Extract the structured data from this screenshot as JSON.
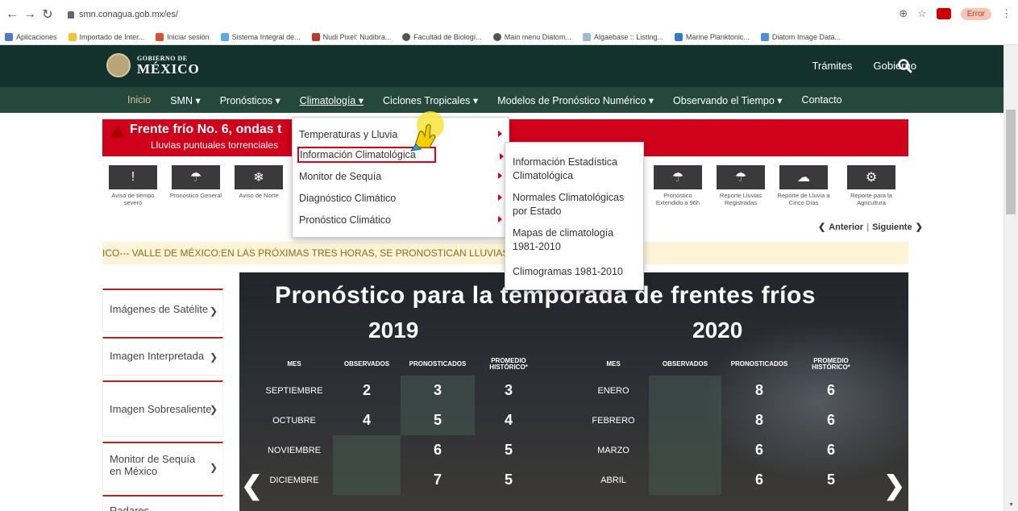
{
  "browser": {
    "url": "smn.conagua.gob.mx/es/",
    "error_label": "Error",
    "bookmarks": [
      "Aplicaciones",
      "Importado de Inter...",
      "Iniciar sesión",
      "Sistema Integral de...",
      "Nudi Pixel: Nudibra...",
      "Facultad de Biologí...",
      "Main menu Diatom...",
      "Algaebase :: Listing...",
      "Marine Planktonic...",
      "Diatom Image Data..."
    ]
  },
  "header": {
    "logo_small": "GOBIERNO DE",
    "logo_big": "MÉXICO",
    "tramites": "Trámites",
    "gobierno": "Gobierno"
  },
  "nav": [
    "Inicio",
    "SMN ▾",
    "Pronósticos ▾",
    "Climatología ▾",
    "Ciclones Tropicales ▾",
    "Modelos de Pronóstico Numérico ▾",
    "Observando el Tiempo ▾",
    "Contacto"
  ],
  "alert": {
    "title": "Frente frío No. 6, ondas t",
    "subtitle": "Lluvias puntuales torrenciales"
  },
  "quick_links": [
    {
      "label": "Aviso de tiempo severo",
      "icon": "!"
    },
    {
      "label": "Pronóstico General",
      "icon": "☂"
    },
    {
      "label": "Aviso de Norte",
      "icon": "❄"
    },
    {
      "label": "Pronóstico Extendido a 96h",
      "icon": "☂"
    },
    {
      "label": "Reporte Lluvias Registradas",
      "icon": "☂"
    },
    {
      "label": "Reporte de Lluvia a Cinco Días",
      "icon": "☁"
    },
    {
      "label": "Reporte para la Agricultura",
      "icon": "⚙"
    }
  ],
  "pager": {
    "prev": "Anterior",
    "next": "Siguiente"
  },
  "ticker": "ICO--- VALLE DE MÉXICO:EN LAS PRÓXIMAS TRES HORAS, SE PRONOSTICAN LLUVIAS                                                  E MÉXICO---",
  "sidebar": [
    "Imágenes de Satélite",
    "Imagen Interpretada",
    "Imagen Sobresaliente",
    "Monitor de Sequía en México",
    "Radares"
  ],
  "hero": {
    "title": "Pronóstico para la temporada de frentes fríos",
    "year_left": "2019",
    "year_right": "2020",
    "headers": [
      "MES",
      "OBSERVADOS",
      "PRONOSTICADOS",
      "PROMEDIO HISTÓRICO*"
    ],
    "rows_2019": [
      [
        "SEPTIEMBRE",
        "2",
        "3",
        "3"
      ],
      [
        "OCTUBRE",
        "4",
        "5",
        "4"
      ],
      [
        "NOVIEMBRE",
        "",
        "6",
        "5"
      ],
      [
        "DICIEMBRE",
        "",
        "7",
        "5"
      ]
    ],
    "rows_2020": [
      [
        "ENERO",
        "",
        "8",
        "6"
      ],
      [
        "FEBRERO",
        "",
        "8",
        "6"
      ],
      [
        "MARZO",
        "",
        "6",
        "6"
      ],
      [
        "ABRIL",
        "",
        "6",
        "5"
      ]
    ]
  },
  "dropdown": {
    "items": [
      "Temperaturas y Lluvia",
      "Información Climatológica",
      "Monitor de Sequía",
      "Diagnóstico Climático",
      "Pronóstico Climático"
    ],
    "sub_items": [
      "Información Estadística Climatológica",
      "Normales Climatológicas por Estado",
      "Mapas de climatología 1981-2010",
      "Climogramas 1981-2010"
    ]
  },
  "colors": {
    "header_dark": "#13322b",
    "nav_green": "#24483b",
    "alert_red": "#d0021b",
    "highlight_red": "#e0001b"
  }
}
